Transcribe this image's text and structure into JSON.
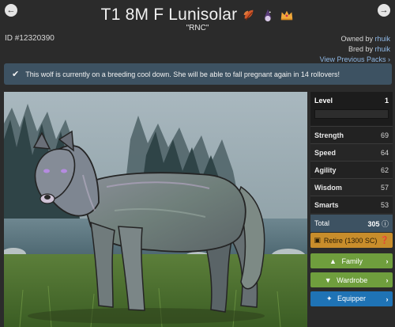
{
  "header": {
    "title": "T1 8M F Lunisolar",
    "nickname": "\"RNC\"",
    "badges": [
      "leaf-badge-icon",
      "wizard-badge-icon",
      "crown-badge-icon"
    ]
  },
  "nav": {
    "prev_icon": "arrow-left-icon",
    "next_icon": "arrow-right-icon"
  },
  "wolf": {
    "id": "ID #12320390",
    "owned_by_label": "Owned by",
    "owner": "rhuik",
    "bred_by_label": "Bred by",
    "breeder": "rhuik",
    "view_packs": "View Previous Packs"
  },
  "notice": {
    "text": "This wolf is currently on a breeding cool down. She will be able to fall pregnant again in 14 rollovers!"
  },
  "stats": {
    "level_label": "Level",
    "level_value": "1",
    "rows": [
      {
        "label": "Strength",
        "value": "69"
      },
      {
        "label": "Speed",
        "value": "64"
      },
      {
        "label": "Agility",
        "value": "62"
      },
      {
        "label": "Wisdom",
        "value": "57"
      },
      {
        "label": "Smarts",
        "value": "53"
      }
    ],
    "total_label": "Total",
    "total_value": "305"
  },
  "actions": {
    "retire": "Retire (1300 SC)",
    "family": "Family",
    "wardrobe": "Wardrobe",
    "equipper": "Equipper"
  },
  "colors": {
    "background": "#2b2b2b",
    "notice": "#3d5262",
    "retire": "#c88d2b",
    "family": "#6f9e3d",
    "equipper": "#1f73b5",
    "link": "#8fb9e6"
  }
}
